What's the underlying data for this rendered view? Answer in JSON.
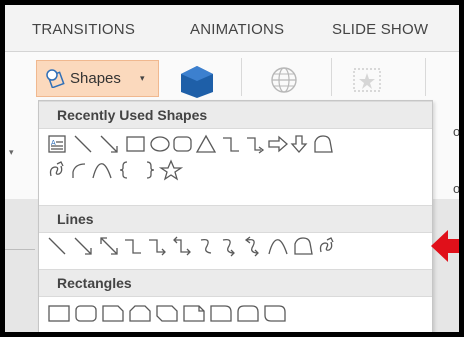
{
  "ribbon_tabs": [
    "TRANSITIONS",
    "ANIMATIONS",
    "SLIDE SHOW"
  ],
  "shapes_button": {
    "label": "Shapes",
    "caret": "▾"
  },
  "ribbon_side_letters": [
    "o",
    "o"
  ],
  "dropdown": {
    "sections": [
      {
        "title": "Recently Used Shapes"
      },
      {
        "title": "Lines"
      },
      {
        "title": "Rectangles"
      }
    ]
  },
  "icons": {
    "shapes_button": "shapes-icon",
    "ribbon_cube": "cube-icon",
    "ribbon_globe": "online-pictures-icon",
    "ribbon_star": "picture-star-icon",
    "callout": "red-arrow-icon"
  },
  "colors": {
    "accent": "#fbd9bd",
    "shape_stroke": "#5a5a5a",
    "arrow_red": "#e0101a",
    "cube_blue": "#1e5fa8"
  }
}
